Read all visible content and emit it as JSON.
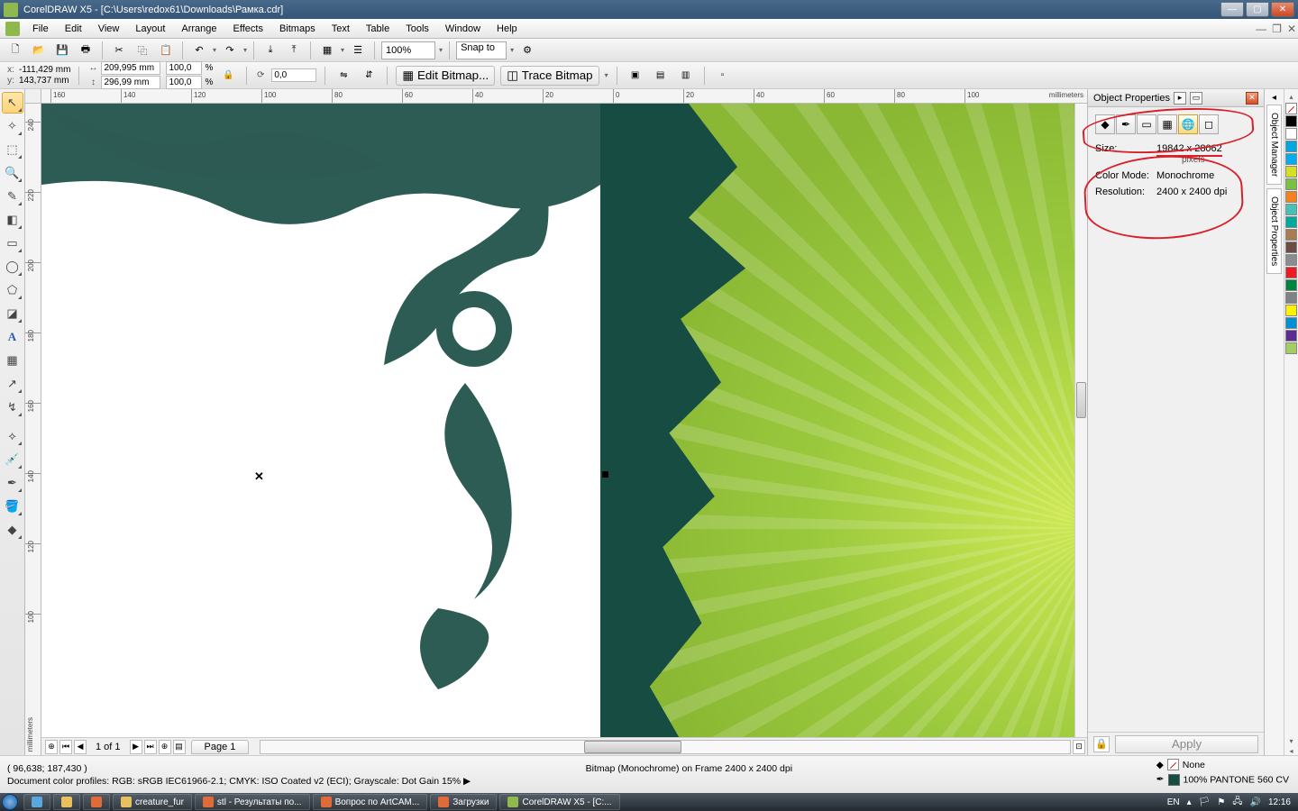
{
  "title": "CorelDRAW X5 - [C:\\Users\\redox61\\Downloads\\Рамка.cdr]",
  "menus": [
    "File",
    "Edit",
    "View",
    "Layout",
    "Arrange",
    "Effects",
    "Bitmaps",
    "Text",
    "Table",
    "Tools",
    "Window",
    "Help"
  ],
  "toolbar": {
    "zoom": "100%",
    "snap": "Snap to"
  },
  "propbar": {
    "x": "-111,429 mm",
    "y": "143,737 mm",
    "w": "209,995 mm",
    "h": "296,99 mm",
    "sx": "100,0",
    "sy": "100,0",
    "pct": "%",
    "rot": "0,0",
    "edit_bitmap": "Edit Bitmap...",
    "trace_bitmap": "Trace Bitmap"
  },
  "hruler": {
    "unit": "millimeters",
    "ticks": [
      "160",
      "140",
      "120",
      "100",
      "80",
      "60",
      "40",
      "20",
      "0",
      "20",
      "40",
      "60",
      "80",
      "100"
    ]
  },
  "vruler": {
    "unit": "millimeters",
    "ticks": [
      "240",
      "220",
      "200",
      "180",
      "160",
      "140",
      "120",
      "100"
    ]
  },
  "pages": {
    "label": "1 of 1",
    "tab": "Page 1"
  },
  "docker": {
    "title": "Object Properties",
    "size_label": "Size:",
    "size_value": "19842 x 28062",
    "size_unit": "pixels",
    "colormode_label": "Color Mode:",
    "colormode_value": "Monochrome",
    "resolution_label": "Resolution:",
    "resolution_value": "2400 x 2400 dpi",
    "apply": "Apply"
  },
  "side_tabs": [
    "Object Manager",
    "Object Properties"
  ],
  "status": {
    "cursor": "( 96,638; 187,430 )",
    "info": "Bitmap (Monochrome) on Frame 2400 x 2400 dpi",
    "profiles": "Document color profiles: RGB: sRGB IEC61966-2.1; CMYK: ISO Coated v2 (ECI); Grayscale: Dot Gain 15%  ▶",
    "fill_none": "None",
    "outline": "100% PANTONE 560 CV"
  },
  "taskbar": {
    "items": [
      "creature_fur",
      "stl - Результаты по...",
      "Вопрос по ArtCAM...",
      "Загрузки",
      "CorelDRAW X5 - [C:..."
    ],
    "lang": "EN",
    "time": "12:16"
  },
  "palette": [
    "#000000",
    "#ffffff",
    "#00a7e1",
    "#00aeef",
    "#d7df23",
    "#7ac143",
    "#f58220",
    "#48c0b6",
    "#00a99d",
    "#a97c50",
    "#6d4c41",
    "#8a8d8f",
    "#ed1c24",
    "#00853f",
    "#808285",
    "#fff200",
    "#008fd5",
    "#5c2d91",
    "#a3cf62"
  ]
}
